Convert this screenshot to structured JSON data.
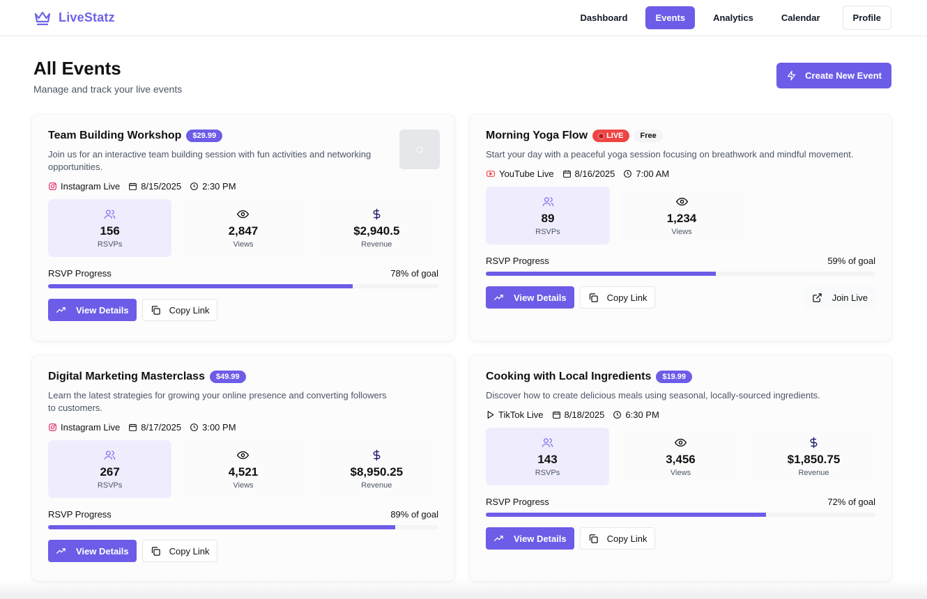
{
  "app": {
    "name": "LiveStatz"
  },
  "nav": {
    "items": [
      {
        "label": "Dashboard",
        "active": false
      },
      {
        "label": "Events",
        "active": true
      },
      {
        "label": "Analytics",
        "active": false
      },
      {
        "label": "Calendar",
        "active": false
      },
      {
        "label": "Profile",
        "active": false
      }
    ]
  },
  "page": {
    "title": "All Events",
    "subtitle": "Manage and track your live events",
    "create_label": "Create New Event"
  },
  "labels": {
    "rsvps": "RSVPs",
    "views": "Views",
    "revenue": "Revenue",
    "rsvp_progress": "RSVP Progress",
    "view_details": "View Details",
    "copy_link": "Copy Link",
    "join_live": "Join Live",
    "live": "LIVE",
    "free": "Free"
  },
  "events": [
    {
      "title": "Team Building Workshop",
      "price": "$29.99",
      "description": "Join us for an interactive team building session with fun activities and networking opportunities.",
      "platform": "Instagram Live",
      "date": "8/15/2025",
      "time": "2:30 PM",
      "rsvps": "156",
      "views": "2,847",
      "revenue": "$2,940.5",
      "progress_text": "78% of goal",
      "progress": 0.78
    },
    {
      "title": "Morning Yoga Flow",
      "description": "Start your day with a peaceful yoga session focusing on breathwork and mindful movement.",
      "platform": "YouTube Live",
      "date": "8/16/2025",
      "time": "7:00 AM",
      "rsvps": "89",
      "views": "1,234",
      "progress_text": "59% of goal",
      "progress": 0.59
    },
    {
      "title": "Digital Marketing Masterclass",
      "price": "$49.99",
      "description": "Learn the latest strategies for growing your online presence and converting followers to customers.",
      "platform": "Instagram Live",
      "date": "8/17/2025",
      "time": "3:00 PM",
      "rsvps": "267",
      "views": "4,521",
      "revenue": "$8,950.25",
      "progress_text": "89% of goal",
      "progress": 0.89
    },
    {
      "title": "Cooking with Local Ingredients",
      "price": "$19.99",
      "description": "Discover how to create delicious meals using seasonal, locally-sourced ingredients.",
      "platform": "TikTok Live",
      "date": "8/18/2025",
      "time": "6:30 PM",
      "rsvps": "143",
      "views": "3,456",
      "revenue": "$1,850.75",
      "progress_text": "72% of goal",
      "progress": 0.72
    }
  ],
  "colors": {
    "accent": "#6c5ce7",
    "live": "#ef4444"
  }
}
